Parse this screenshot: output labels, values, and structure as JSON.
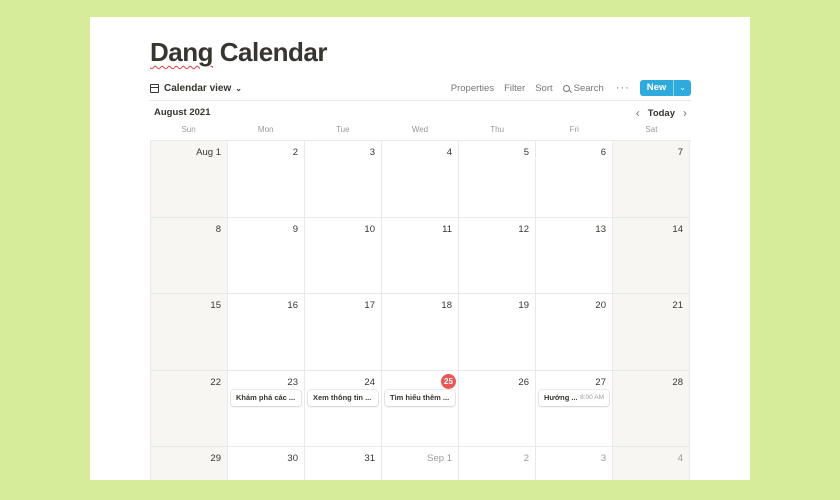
{
  "page": {
    "title_word1": "Dang",
    "title_word2": "Calendar"
  },
  "toolbar": {
    "view_label": "Calendar view",
    "properties_label": "Properties",
    "filter_label": "Filter",
    "sort_label": "Sort",
    "search_label": "Search",
    "more_label": "···",
    "new_label": "New",
    "accent_color": "#2eaadc"
  },
  "calendar": {
    "month_label": "August 2021",
    "today_label": "Today",
    "weekdays": [
      "Sun",
      "Mon",
      "Tue",
      "Wed",
      "Thu",
      "Fri",
      "Sat"
    ],
    "days": [
      "Aug 1",
      "2",
      "3",
      "4",
      "5",
      "6",
      "7",
      "8",
      "9",
      "10",
      "11",
      "12",
      "13",
      "14",
      "15",
      "16",
      "17",
      "18",
      "19",
      "20",
      "21",
      "22",
      "23",
      "24",
      "25",
      "26",
      "27",
      "28",
      "29",
      "30",
      "31",
      "Sep 1",
      "2",
      "3",
      "4"
    ],
    "today_index": 24,
    "today_color": "#eb5757",
    "events": [
      {
        "day_index": 22,
        "title": "Khám phá các ...",
        "time": ""
      },
      {
        "day_index": 23,
        "title": "Xem thông tin ...",
        "time": ""
      },
      {
        "day_index": 24,
        "title": "Tìm hiểu thêm ...",
        "time": ""
      },
      {
        "day_index": 26,
        "title": "Hướng ...",
        "time": "8:00 AM"
      }
    ]
  }
}
